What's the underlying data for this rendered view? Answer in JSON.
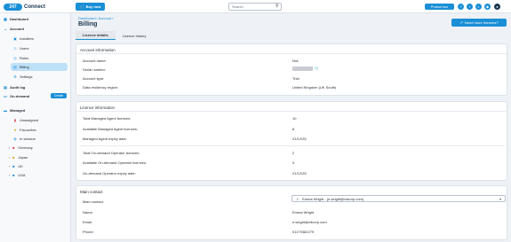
{
  "header": {
    "logo_mark": "247",
    "logo_text": "Connect",
    "buy_now": "Buy now",
    "search_placeholder": "Search",
    "product_tour": "Product tour"
  },
  "sidebar": {
    "items": [
      {
        "label": "Dashboard",
        "icon": "grid-icon"
      },
      {
        "label": "Account",
        "icon": "chevron-down-icon"
      },
      {
        "label": "Installers",
        "icon": "installers-icon"
      },
      {
        "label": "Users",
        "icon": "users-icon"
      },
      {
        "label": "Roles",
        "icon": "roles-icon"
      },
      {
        "label": "Billing",
        "icon": "billing-icon"
      },
      {
        "label": "Settings",
        "icon": "gear-icon"
      },
      {
        "label": "Audit log",
        "icon": "log-icon"
      },
      {
        "label": "On-demand",
        "icon": "on-demand-icon"
      },
      {
        "label": "Managed",
        "icon": "managed-icon"
      },
      {
        "label": "Unassigned",
        "icon": "unassigned-icon"
      },
      {
        "label": "Favourites",
        "icon": "star-icon"
      },
      {
        "label": "In session",
        "icon": "session-icon"
      },
      {
        "label": "Germany",
        "icon": "flag-icon"
      },
      {
        "label": "Japan",
        "icon": "flag-icon"
      },
      {
        "label": "UK",
        "icon": "folder-icon"
      },
      {
        "label": "USA",
        "icon": "folder-icon"
      }
    ],
    "create_label": "Create"
  },
  "main": {
    "breadcrumb": "Dashboard / Account /",
    "title": "Billing",
    "need_more": "Need more licences?",
    "tabs": [
      "Licence details",
      "Licence history"
    ]
  },
  "account_info": {
    "title": "Account information",
    "rows": [
      {
        "label": "Account name:",
        "value": "N/A"
      },
      {
        "label": "Serial number:",
        "value": ""
      },
      {
        "label": "Account type:",
        "value": "Trial"
      },
      {
        "label": "Data residency region:",
        "value": "United Kingdom (UK South)"
      }
    ]
  },
  "licence_info": {
    "title": "Licence information",
    "rows": [
      {
        "label": "Total Managed Agent licences:",
        "value": "10"
      },
      {
        "label": "Available Managed Agent licences:",
        "value": "8"
      },
      {
        "label": "Managed Agent expiry date:",
        "value": "21/12/25"
      },
      {
        "label": "Total On-demand Operator licences:",
        "value": "2"
      },
      {
        "label": "Available On-demand Operator licences:",
        "value": "0"
      },
      {
        "label": "On-demand Operator expiry date:",
        "value": "21/12/25"
      }
    ]
  },
  "main_contact": {
    "title": "Main contact",
    "select_label": "Main contact:",
    "select_value": "Emma Wright - (e.wright@mlcorp.com)",
    "rows": [
      {
        "label": "Name:",
        "value": "Emma Wright"
      },
      {
        "label": "Email:",
        "value": "e.wright@mlcorp.com"
      },
      {
        "label": "Phone:",
        "value": "01179382279"
      }
    ]
  },
  "colors": {
    "accent": "#1a8fd6",
    "active_nav": "#bde0f7"
  }
}
